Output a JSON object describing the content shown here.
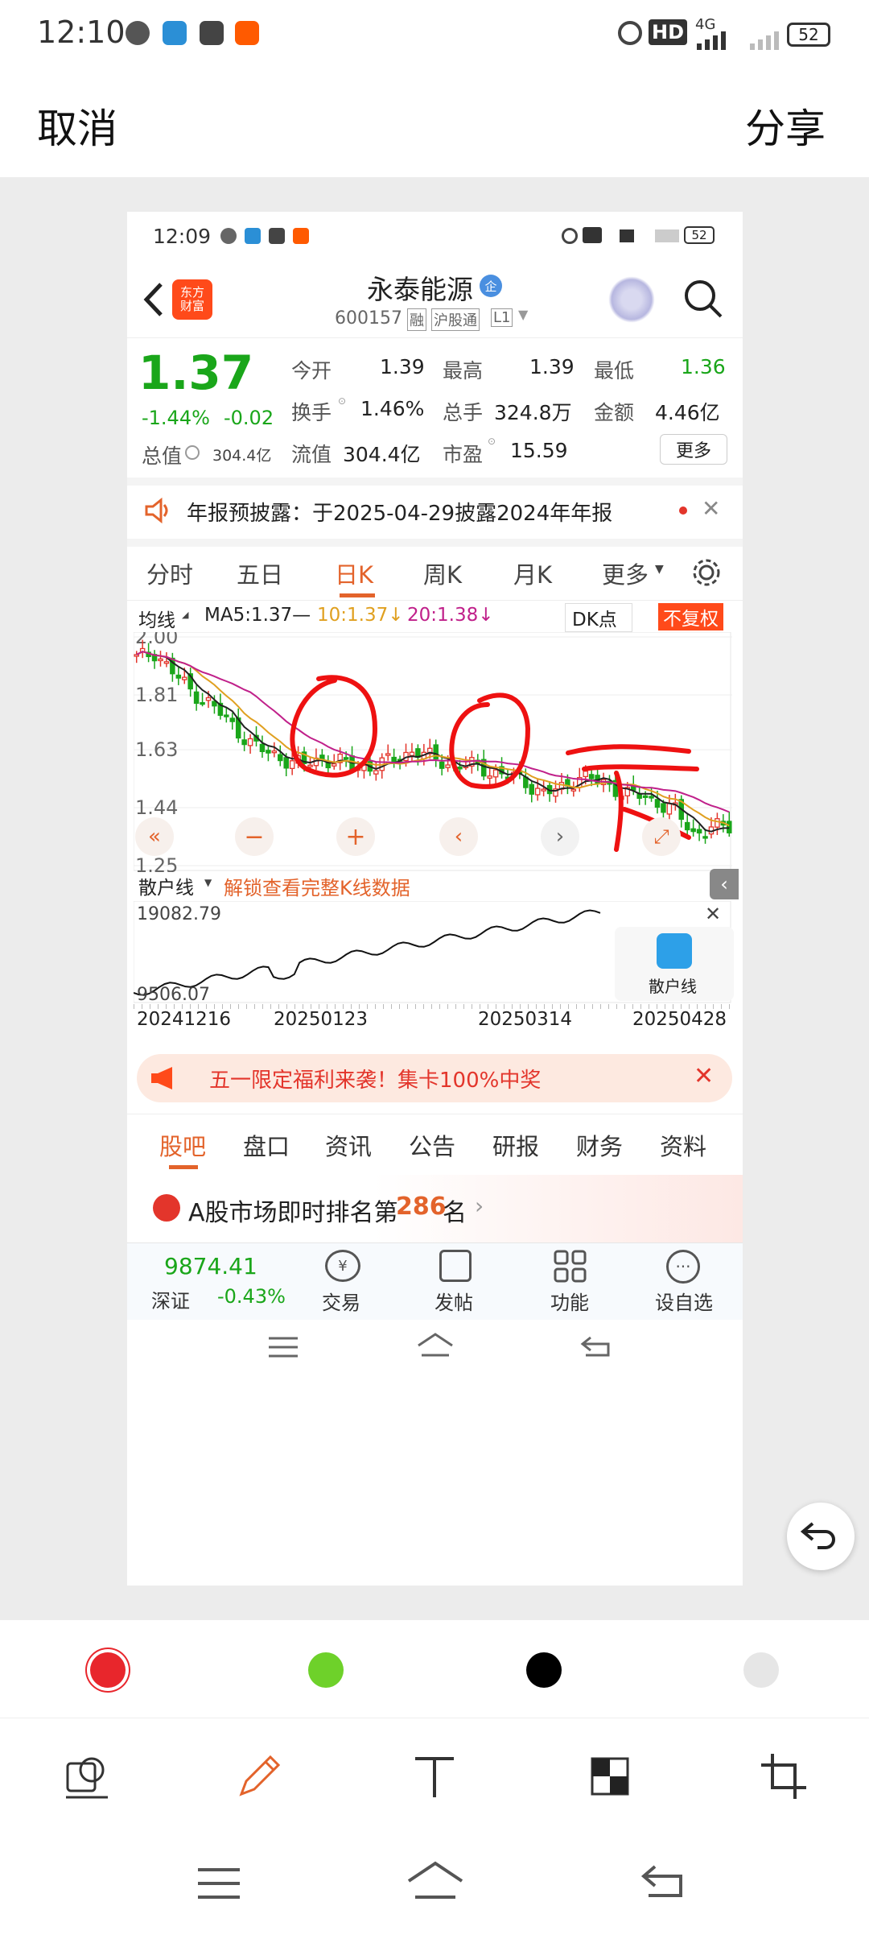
{
  "status_bar": {
    "time": "12:10",
    "battery": "52",
    "network": "4G",
    "hd": "HD"
  },
  "header": {
    "cancel": "取消",
    "share": "分享"
  },
  "inner": {
    "status": {
      "time": "12:09",
      "battery": "52"
    },
    "stock": {
      "name": "永泰能源",
      "code": "600157",
      "tag1": "融",
      "tag2": "沪股通",
      "tag3": "L1",
      "logo": "东方财富"
    },
    "price": {
      "last": "1.37",
      "change_pct": "-1.44%",
      "change": "-0.02",
      "total_value_label": "总值",
      "total_value": "304.4亿"
    },
    "metrics": [
      {
        "label": "今开",
        "value": "1.39"
      },
      {
        "label": "最高",
        "value": "1.39"
      },
      {
        "label": "最低",
        "value": "1.36"
      },
      {
        "label": "换手",
        "value": "1.46%"
      },
      {
        "label": "总手",
        "value": "324.8万"
      },
      {
        "label": "金额",
        "value": "4.46亿"
      },
      {
        "label": "流值",
        "value": "304.4亿"
      },
      {
        "label": "市盈",
        "value": "15.59"
      }
    ],
    "more_button": "更多",
    "notice": "年报预披露：于2025-04-29披露2024年年报",
    "tabs": [
      "分时",
      "五日",
      "日K",
      "周K",
      "月K",
      "更多"
    ],
    "active_tab": "日K",
    "ma_bar": {
      "selector": "均线",
      "ma5": "MA5:1.37—",
      "ma10": "10:1.37↓",
      "ma20": "20:1.38↓",
      "dk": "DK点",
      "fq": "不复权"
    },
    "subchart": {
      "selector": "散户线",
      "unlock": "解锁查看完整K线数据",
      "top": "19082.79",
      "bottom": "9506.07",
      "badge": "散户线"
    },
    "dates": [
      "20241216",
      "20250123",
      "20250314",
      "20250428"
    ],
    "promo": "五一限定福利来袭！集卡100%中奖",
    "bottom_tabs": [
      "股吧",
      "盘口",
      "资讯",
      "公告",
      "研报",
      "财务",
      "资料"
    ],
    "rank": {
      "prefix": "A股市场即时排名第",
      "number": "286",
      "suffix": "名"
    },
    "index": {
      "value": "9874.41",
      "name": "深证",
      "change": "-0.43%"
    },
    "actions": [
      "交易",
      "发帖",
      "功能",
      "设自选"
    ]
  },
  "chart_data": {
    "type": "candlestick",
    "y_ticks": [
      "2.00",
      "1.81",
      "1.63",
      "1.44",
      "1.25"
    ],
    "ylim": [
      1.25,
      2.0
    ],
    "close_trend_approx": [
      1.93,
      1.95,
      1.88,
      1.82,
      1.78,
      1.72,
      1.66,
      1.62,
      1.6,
      1.58,
      1.6,
      1.59,
      1.57,
      1.58,
      1.6,
      1.63,
      1.6,
      1.58,
      1.58,
      1.56,
      1.55,
      1.52,
      1.49,
      1.5,
      1.55,
      1.52,
      1.5,
      1.48,
      1.46,
      1.44,
      1.35,
      1.38,
      1.37
    ]
  },
  "colors": {
    "up": "#e3352b",
    "down": "#1aa61a",
    "accent": "#e3632b",
    "annotation": "#ee1111"
  },
  "palette": [
    "#e8262c",
    "#6ed12a",
    "#000000",
    "#e6e6e6"
  ],
  "tools": [
    "layers-icon",
    "pencil-icon",
    "text-icon",
    "mosaic-icon",
    "crop-icon"
  ]
}
